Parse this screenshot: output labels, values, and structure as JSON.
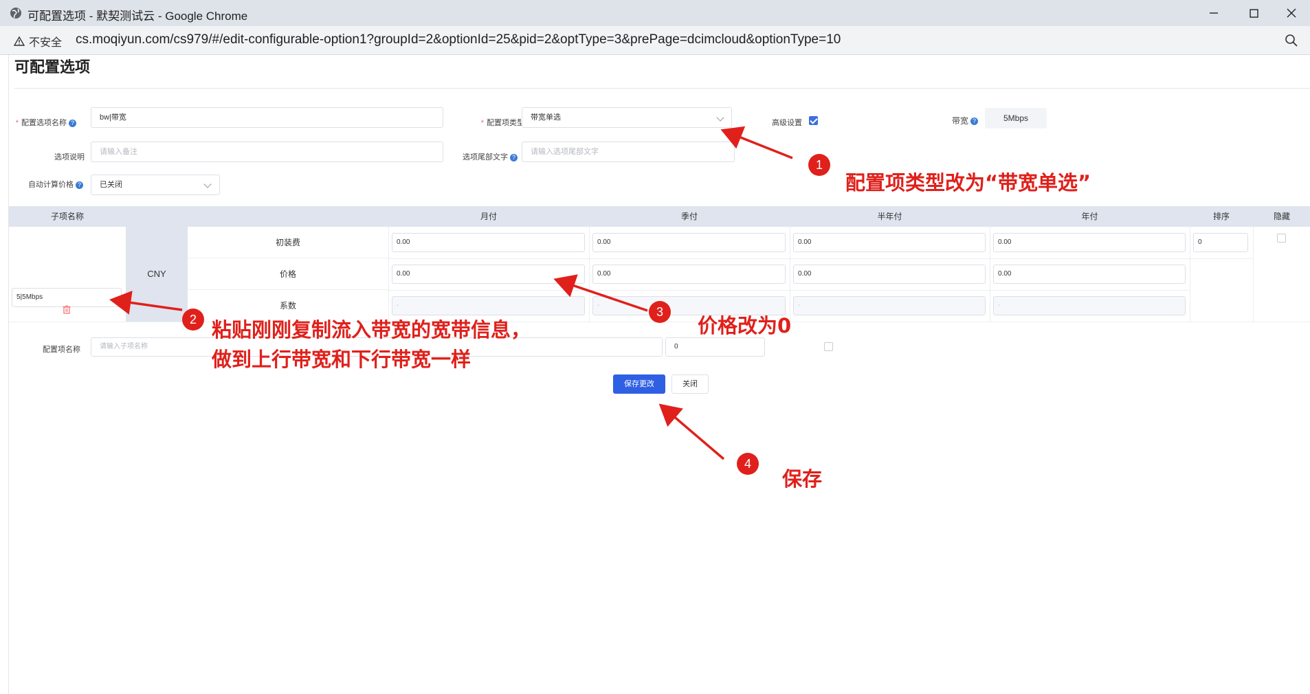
{
  "browser": {
    "window_title": "可配置选项 - 默契测试云 - Google Chrome",
    "security_label": "不安全",
    "url": "cs.moqiyun.com/cs979/#/edit-configurable-option1?groupId=2&optionId=25&pid=2&optType=3&prePage=dcimcloud&optionType=10"
  },
  "page": {
    "title": "可配置选项"
  },
  "form": {
    "option_name_label": "配置选项名称",
    "option_name_value": "bw|带宽",
    "option_type_label": "配置项类型",
    "option_type_value": "带宽单选",
    "advanced_label": "高级设置",
    "advanced_checked": true,
    "bandwidth_label": "带宽",
    "bandwidth_value": "5Mbps",
    "desc_label": "选项说明",
    "desc_placeholder": "请输入备注",
    "suffix_label": "选项尾部文字",
    "suffix_placeholder": "请输入选项尾部文字",
    "auto_price_label": "自动计算价格",
    "auto_price_value": "已关闭"
  },
  "table": {
    "headers": {
      "sub_name": "子项名称",
      "monthly": "月付",
      "quarterly": "季付",
      "semiannual": "半年付",
      "annual": "年付",
      "sort": "排序",
      "hidden": "隐藏"
    },
    "currency": "CNY",
    "row_labels": [
      "初装费",
      "价格",
      "系数"
    ],
    "sub_name_value": "5|5Mbps",
    "setup_fee": [
      "0.00",
      "0.00",
      "0.00",
      "0.00"
    ],
    "price": [
      "0.00",
      "0.00",
      "0.00",
      "0.00"
    ],
    "coef_placeholder": "-",
    "sort_value": "0",
    "new_row": {
      "label": "配置项名称",
      "placeholder": "请输入子项名称",
      "sort_value": "0"
    }
  },
  "buttons": {
    "save": "保存更改",
    "close": "关闭"
  },
  "annotations": {
    "step1_num": "1",
    "step1_text": "配置项类型改为“带宽单选”",
    "step2_num": "2",
    "step2_line1": "粘贴刚刚复制流入带宽的宽带信息，",
    "step2_line2": "做到上行带宽和下行带宽一样",
    "step3_num": "3",
    "step3_text": "价格改为0",
    "step4_num": "4",
    "step4_text": "保存",
    "color": "#e0201b"
  }
}
